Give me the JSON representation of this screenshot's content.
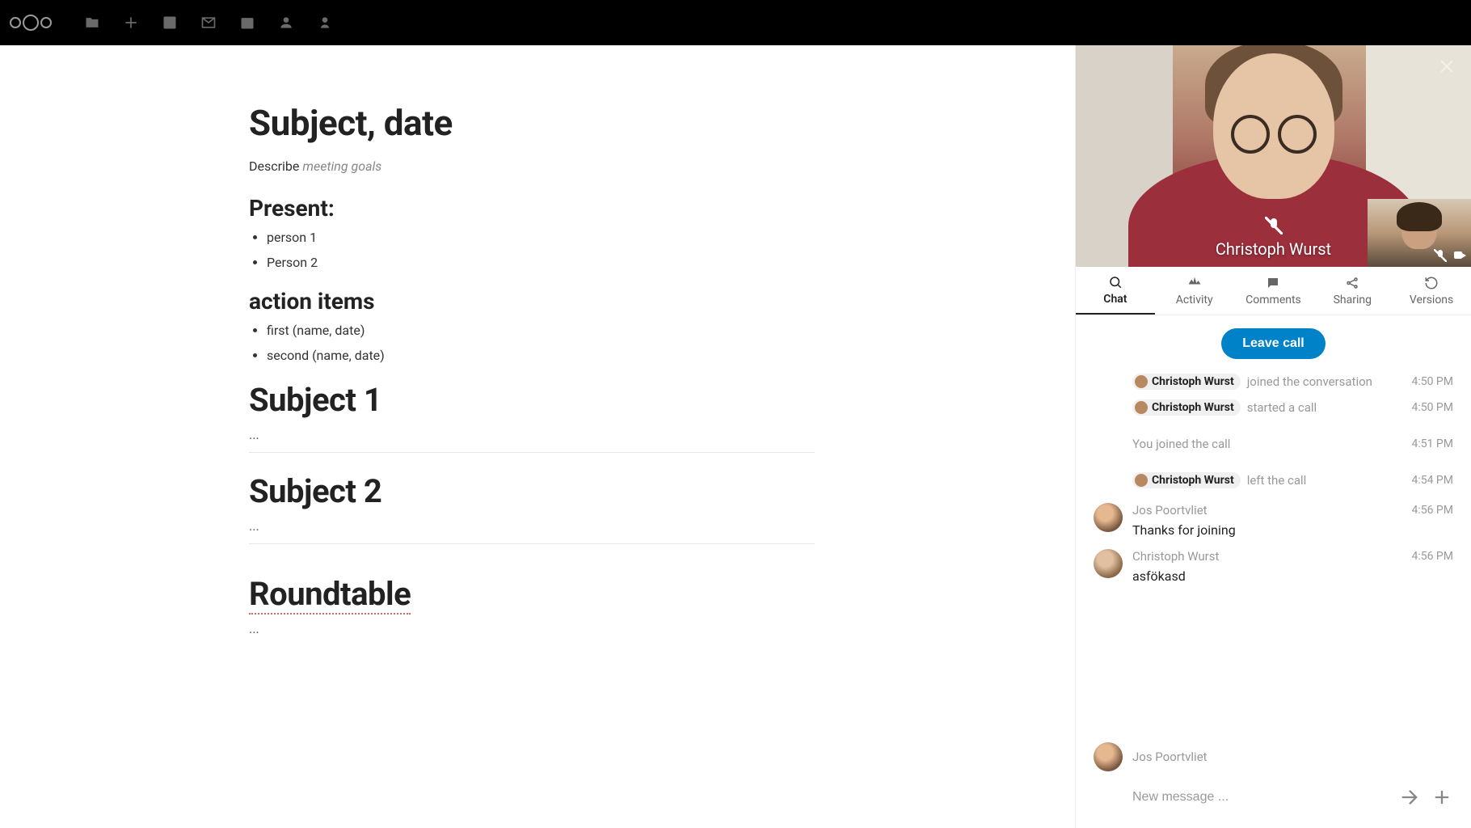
{
  "topbar": {
    "nav_icons": [
      "files",
      "plus",
      "dashboard",
      "mail",
      "calendar",
      "contacts",
      "more"
    ]
  },
  "document": {
    "title": "Subject, date",
    "describe_label": "Describe ",
    "describe_hint": "meeting goals",
    "present_heading": "Present:",
    "present_items": [
      "person 1",
      "Person 2"
    ],
    "action_heading": "action items",
    "action_items": [
      "first (name, date)",
      "second (name, date)"
    ],
    "subject1": "Subject 1",
    "subject1_body": "...",
    "subject2": "Subject 2",
    "subject2_body": "...",
    "roundtable": "Roundtable",
    "roundtable_body": "..."
  },
  "video": {
    "main_name": "Christoph Wurst"
  },
  "tabs": [
    {
      "id": "chat",
      "label": "Chat"
    },
    {
      "id": "activity",
      "label": "Activity"
    },
    {
      "id": "comments",
      "label": "Comments"
    },
    {
      "id": "sharing",
      "label": "Sharing"
    },
    {
      "id": "versions",
      "label": "Versions"
    }
  ],
  "chat": {
    "leave_label": "Leave call",
    "events": [
      {
        "chip": "Christoph Wurst",
        "text": "joined the conversation",
        "time": "4:50 PM"
      },
      {
        "chip": "Christoph Wurst",
        "text": "started a call",
        "time": "4:50 PM"
      },
      {
        "plain": "You joined the call",
        "time": "4:51 PM"
      },
      {
        "chip": "Christoph Wurst",
        "text": "left the call",
        "time": "4:54 PM"
      }
    ],
    "messages": [
      {
        "author": "Jos Poortvliet",
        "time": "4:56 PM",
        "text": "Thanks for joining",
        "avatar": "a1"
      },
      {
        "author": "Christoph Wurst",
        "time": "4:56 PM",
        "text": "asfökasd",
        "avatar": "a2"
      }
    ],
    "typing": {
      "author": "Jos Poortvliet"
    },
    "composer_placeholder": "New message ..."
  }
}
